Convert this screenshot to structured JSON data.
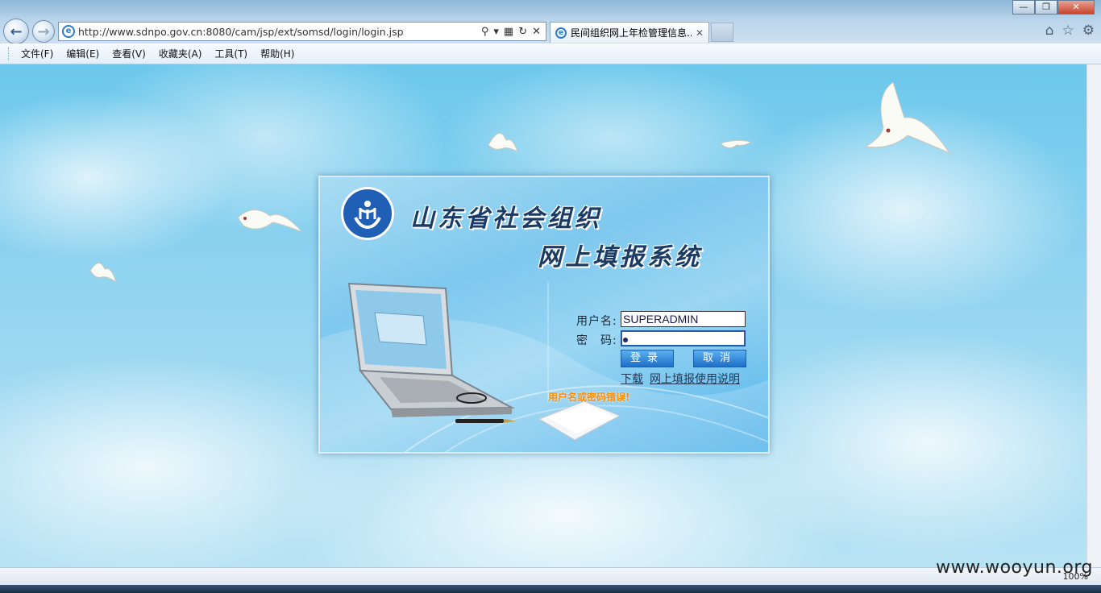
{
  "browser": {
    "url": "http://www.sdnpo.gov.cn:8080/cam/jsp/ext/somsd/login/login.jsp",
    "tab_title": "民间组织网上年检管理信息...",
    "zoom": "100%"
  },
  "menu": {
    "items": [
      "文件(F)",
      "编辑(E)",
      "查看(V)",
      "收藏夹(A)",
      "工具(T)",
      "帮助(H)"
    ]
  },
  "login": {
    "title_line1": "山东省社会组织",
    "title_line2": "网上填报系统",
    "username_label": "用户名:",
    "password_label": "密　码:",
    "username_value": "SUPERADMIN",
    "login_button": "登录",
    "cancel_button": "取消",
    "download_text": "下载",
    "manual_link": "网上填报使用说明",
    "error_message": "用户名或密码错误!"
  },
  "watermark": "www.wooyun.org",
  "colors": {
    "error": "#ff8a00",
    "button": "#1e6fc8",
    "logo": "#1f5fb5"
  }
}
